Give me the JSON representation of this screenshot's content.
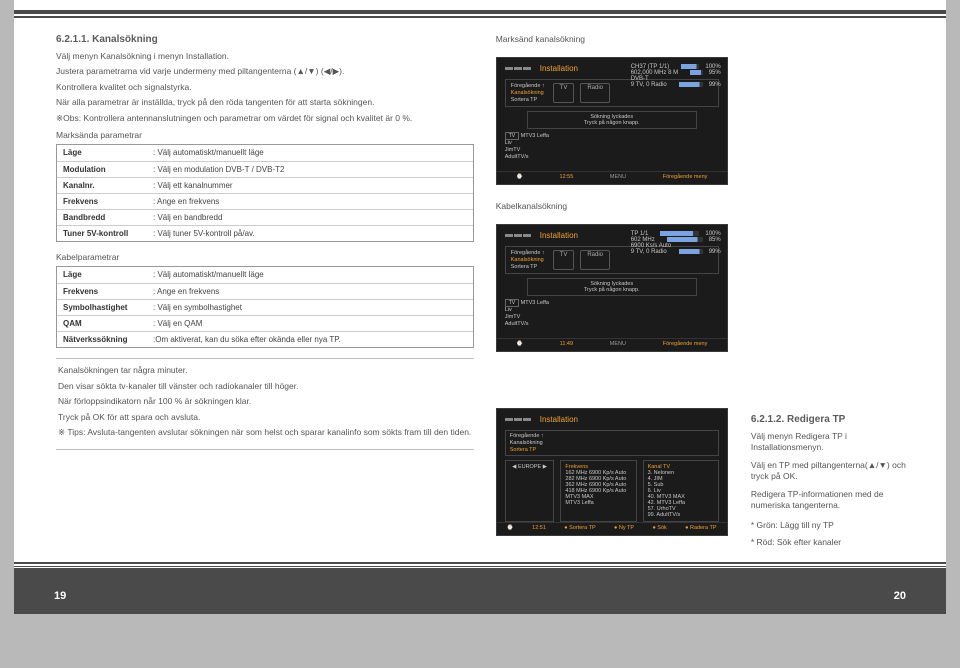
{
  "section_number": "6.2.1.1. Kanalsökning",
  "intro": [
    "Välj menyn Kanalsökning i menyn Installation.",
    "Justera parametrarna vid varje undermeny med piltangenterna (▲/▼) (◀/▶).",
    "Kontrollera kvalitet och signalstyrka.",
    "När alla parametrar är inställda, tryck på den röda tangenten för att starta sökningen.",
    "※Obs: Kontrollera antennanslutningen och parametrar om värdet för signal och kvalitet är 0 %."
  ],
  "marksanda_header": "Marksända parametrar",
  "marksanda": [
    {
      "l": "Läge",
      "r": ": Välj automatiskt/manuellt läge"
    },
    {
      "l": "Modulation",
      "r": ": Välj en modulation DVB-T / DVB-T2"
    },
    {
      "l": "Kanalnr.",
      "r": ": Välj ett kanalnummer"
    },
    {
      "l": "Frekvens",
      "r": ": Ange en frekvens"
    },
    {
      "l": "Bandbredd",
      "r": ": Välj en bandbredd"
    },
    {
      "l": "Tuner 5V-kontroll",
      "r": ": Välj tuner 5V-kontroll på/av."
    }
  ],
  "kabel_header": "Kabelparametrar",
  "kabel": [
    {
      "l": "Läge",
      "r": ": Välj automatiskt/manuellt läge"
    },
    {
      "l": "Frekvens",
      "r": ": Ange en frekvens"
    },
    {
      "l": "Symbolhastighet",
      "r": ": Välj en symbolhastighet"
    },
    {
      "l": "QAM",
      "r": ": Välj en QAM"
    },
    {
      "l": "Nätverkssökning",
      "r": ":Om aktiverat, kan du söka efter okända eller nya TP."
    }
  ],
  "lower_para": [
    "Kanalsökningen tar några minuter.",
    "Den visar sökta tv-kanaler till vänster och radiokanaler till höger.",
    "När förloppsindikatorn når 100 % är sökningen klar.",
    "Tryck på OK för att spara och avsluta.",
    "※ Tips: Avsluta-tangenten avslutar sökningen när som helst och sparar kanalinfo som sökts fram till den tiden."
  ],
  "right_captions": {
    "c1": "Marksänd kanalsökning",
    "c2": "Kabelkanalsökning"
  },
  "far_section_number": "6.2.1.2. Redigera TP",
  "far_para": [
    "Välj menyn Redigera TP i Installationsmenyn.",
    "Välj en TP med piltangenterna(▲/▼) och tryck på OK.",
    "Redigera TP-informationen med de numeriska tangenterna.",
    "* Grön: Lägg till ny TP",
    "* Röd: Sök efter kanaler"
  ],
  "page_left": "19",
  "page_right": "20",
  "shot1": {
    "title": "Installation",
    "info": [
      "CH37 (TP 1/1)",
      "602,000 MHz  8 M",
      "DVB-T",
      "9 TV, 0 Radio"
    ],
    "pct": [
      "100%",
      "95%",
      "99%"
    ],
    "menu": [
      "Föregående ↑",
      "Kanalsökning",
      "Sortera TP"
    ],
    "tabs": [
      "TV",
      "Radio"
    ],
    "msg": [
      "Sökning lyckades",
      "Tryck på någon knapp."
    ],
    "chs": [
      "MTV3 Leffa",
      "Liv",
      "JimTV",
      "AdultTV/s"
    ],
    "time": "12:55",
    "foot": [
      "MENU",
      "Föregående meny"
    ]
  },
  "shot2": {
    "title": "Installation",
    "info": [
      "TP 1/1",
      "602 MHz",
      "6900 Ks/s Auto",
      "9 TV, 0 Radio"
    ],
    "pct": [
      "100%",
      "85%",
      "99%"
    ],
    "menu": [
      "Föregående ↑",
      "Kanalsökning",
      "Sortera TP"
    ],
    "tabs": [
      "TV",
      "Radio"
    ],
    "msg": [
      "Sökning lyckades",
      "Tryck på någon knapp."
    ],
    "chs": [
      "MTV3 Leffa",
      "Liv",
      "JimTV",
      "AdultTV/s"
    ],
    "time": "11:49",
    "foot": [
      "MENU",
      "Föregående meny"
    ]
  },
  "shot3": {
    "title": "Installation",
    "menu": [
      "Föregående ↑",
      "Kanalsökning",
      "Sortera TP"
    ],
    "col_region": "EUROPE",
    "col_freq_h": "Frekvens",
    "col_freq": [
      "162 MHz   6900 Kp/s   Auto",
      "282 MHz   6900 Kp/s   Auto",
      "362 MHz   6900 Kp/s   Auto",
      "418 MHz   6900 Kp/s   Auto",
      "MTV3 MAX",
      "MTV3 Leffa"
    ],
    "col_kanal_h": "Kanal TV",
    "col_kanal": [
      "3. Nelonen",
      "4. JIM",
      "5. Sub",
      "6. Liv",
      "40. MTV3 MAX",
      "42. MTV3 Leffa",
      "57. UrhoTV",
      "99. AdultTV/s"
    ],
    "time": "12:51",
    "foot": [
      "Sortera TP",
      "Ny TP",
      "Sök",
      "Radera TP"
    ]
  }
}
